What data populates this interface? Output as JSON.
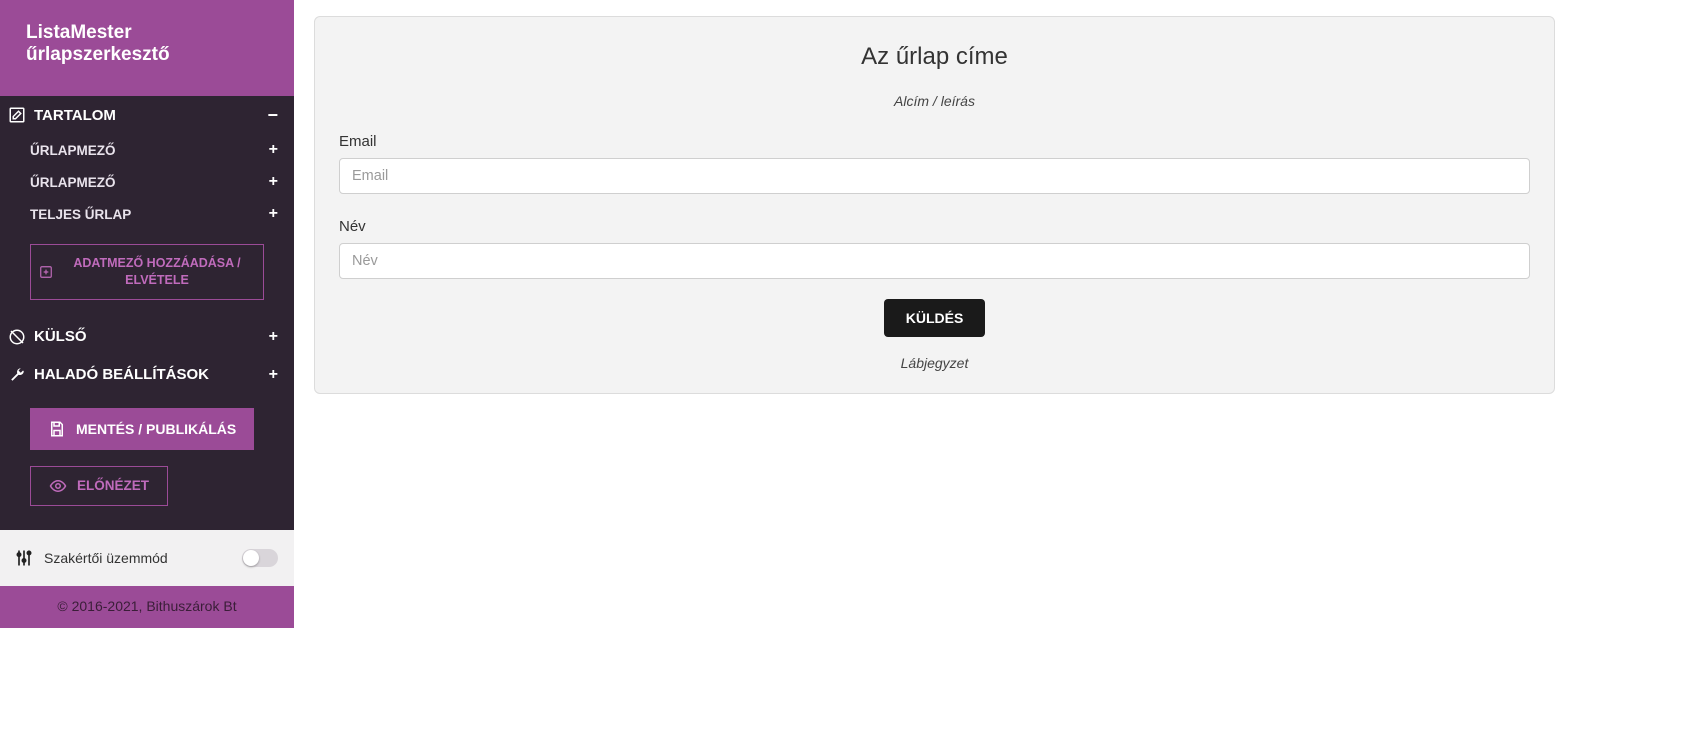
{
  "brand": "ListaMester űrlapszerkesztő",
  "sidebar": {
    "sections": [
      {
        "label": "TARTALOM",
        "expanded": true
      },
      {
        "label": "KÜLSŐ",
        "expanded": false
      },
      {
        "label": "HALADÓ BEÁLLÍTÁSOK",
        "expanded": false
      }
    ],
    "content_items": [
      {
        "label": "ŰRLAPMEZŐ"
      },
      {
        "label": "ŰRLAPMEZŐ"
      },
      {
        "label": "TELJES ŰRLAP"
      }
    ],
    "add_field_button": "ADATMEZŐ HOZZÁADÁSA / ELVÉTELE",
    "save_publish_button": "MENTÉS / PUBLIKÁLÁS",
    "preview_button": "ELŐNÉZET",
    "expert_mode_label": "Szakértői üzemmód",
    "expert_mode_on": false,
    "copyright": "© 2016-2021, Bithuszárok Bt"
  },
  "form": {
    "title": "Az űrlap címe",
    "subtitle": "Alcím / leírás",
    "fields": [
      {
        "label": "Email",
        "placeholder": "Email"
      },
      {
        "label": "Név",
        "placeholder": "Név"
      }
    ],
    "submit_label": "KÜLDÉS",
    "footnote": "Lábjegyzet"
  }
}
